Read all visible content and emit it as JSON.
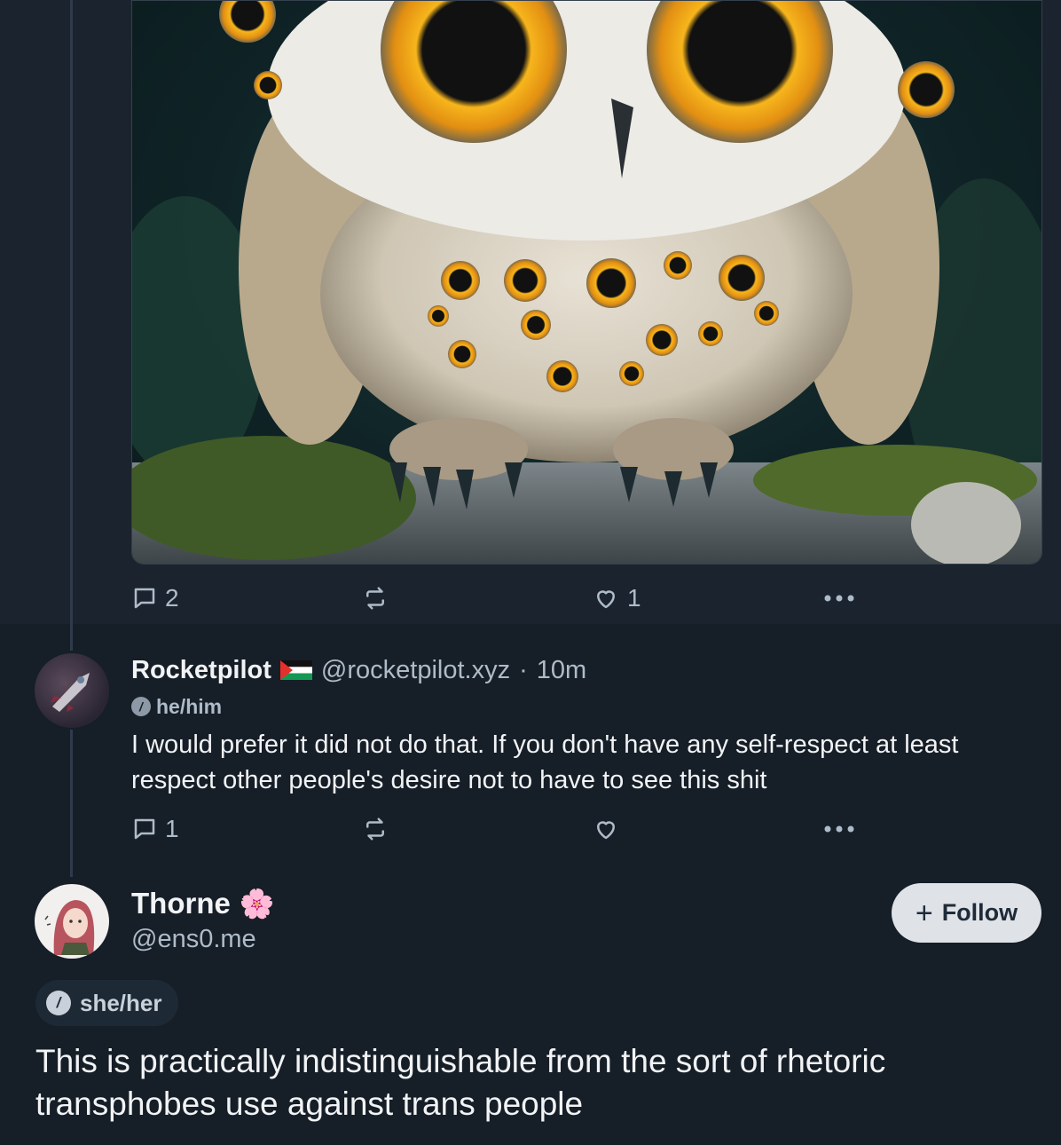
{
  "first_post": {
    "image_alt": "owl covered in eyes",
    "actions": {
      "reply_count": "2",
      "repost_count": "",
      "like_count": "1"
    }
  },
  "reply": {
    "display_name": "Rocketpilot",
    "flag_icon": "palestine-flag-icon",
    "handle": "@rocketpilot.xyz",
    "separator": "·",
    "time": "10m",
    "pronouns": "he/him",
    "text": "I would prefer it did not do that. If you don't have any self-respect at least respect other people's desire not to have to see this shit",
    "actions": {
      "reply_count": "1",
      "repost_count": "",
      "like_count": ""
    }
  },
  "main_post": {
    "display_name": "Thorne",
    "emoji": "🌸",
    "handle": "@ens0.me",
    "follow_label": "Follow",
    "follow_icon": "+",
    "pronouns": "she/her",
    "text": "This is practically indistinguishable from the sort of rhetoric transphobes use against trans people"
  },
  "colors": {
    "background": "#161e27",
    "secondary_text": "#aebbc9",
    "follow_button_bg": "#dfe3e8"
  }
}
